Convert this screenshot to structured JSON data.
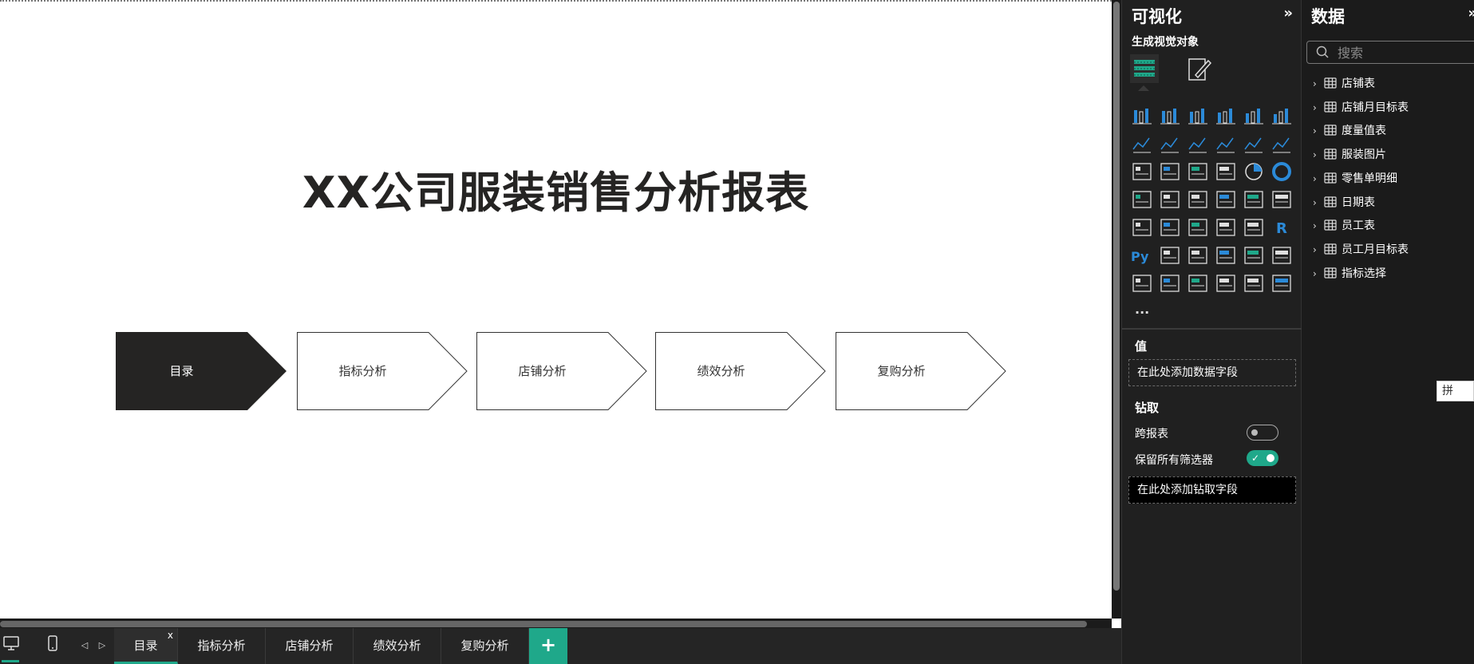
{
  "report": {
    "title": "XX公司服装销售分析报表",
    "nav_buttons": [
      {
        "label": "目录",
        "active": true
      },
      {
        "label": "指标分析",
        "active": false
      },
      {
        "label": "店铺分析",
        "active": false
      },
      {
        "label": "绩效分析",
        "active": false
      },
      {
        "label": "复购分析",
        "active": false
      }
    ]
  },
  "page_tabs": {
    "tabs": [
      "目录",
      "指标分析",
      "店铺分析",
      "绩效分析",
      "复购分析"
    ],
    "active_close": "x",
    "add_label": "+"
  },
  "viz_pane": {
    "title": "可视化",
    "collapse": "»",
    "build_visual": "生成视觉对象",
    "more": "...",
    "values_label": "值",
    "values_well": "在此处添加数据字段",
    "drill_label": "钻取",
    "cross_report": "跨报表",
    "keep_filters": "保留所有筛选器",
    "drill_well": "在此处添加钻取字段",
    "accent": "#1fa88a"
  },
  "data_pane": {
    "title": "数据",
    "collapse": "»",
    "search_placeholder": "搜索",
    "tables": [
      "店铺表",
      "店铺月目标表",
      "度量值表",
      "服装图片",
      "零售单明细",
      "日期表",
      "员工表",
      "员工月目标表",
      "指标选择"
    ]
  },
  "ime": {
    "label": "拼"
  }
}
